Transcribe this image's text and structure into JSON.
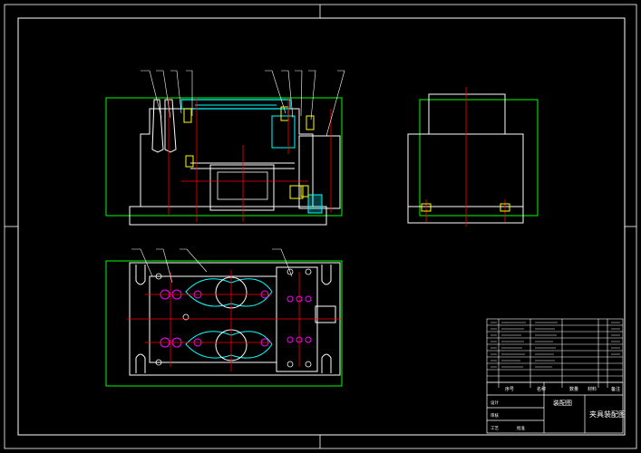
{
  "drawing": {
    "title_block": {
      "drawing_name": "夹具装配图",
      "sheet_label": "装配图",
      "column_headers": [
        "序号",
        "名称",
        "数量",
        "材料",
        "备注"
      ],
      "signature_labels": [
        "设计",
        "审核",
        "工艺",
        "批准"
      ]
    },
    "colors": {
      "background": "#000000",
      "frame": "#ffffff",
      "part": "#ffffff",
      "envelope": "#00ff00",
      "centerline": "#ff0000",
      "leader": "#ffffff",
      "hidden": "#00ffff",
      "fastener": "#ff00ff",
      "hatch": "#ffff00"
    }
  }
}
